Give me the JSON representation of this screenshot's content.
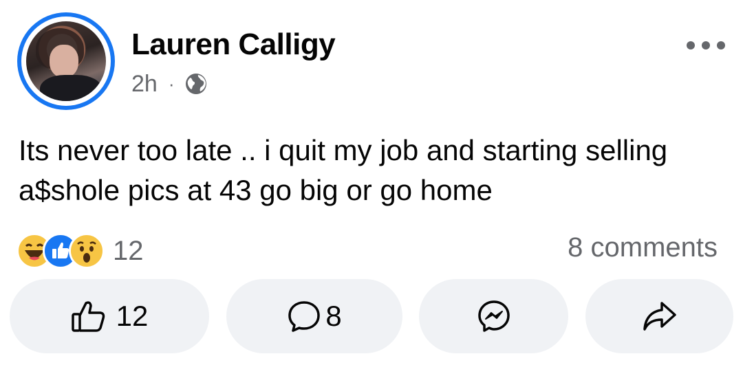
{
  "post": {
    "author": "Lauren Calligy",
    "time": "2h",
    "separator": "·",
    "audience_icon": "globe-icon",
    "text": "Its never too late .. i quit my job and starting selling a$shole pics at 43 go big or go home"
  },
  "stats": {
    "reaction_icons": [
      "haha-reaction-icon",
      "like-reaction-icon",
      "wow-reaction-icon"
    ],
    "reaction_count": "12",
    "comments_label": "8 comments"
  },
  "actions": {
    "like_count": "12",
    "comment_count": "8",
    "messenger_icon": "messenger-icon",
    "share_icon": "share-icon"
  },
  "colors": {
    "accent": "#1877f2",
    "secondary_text": "#65676b",
    "button_bg": "#f0f2f5",
    "reaction_yellow": "#f7c544"
  }
}
